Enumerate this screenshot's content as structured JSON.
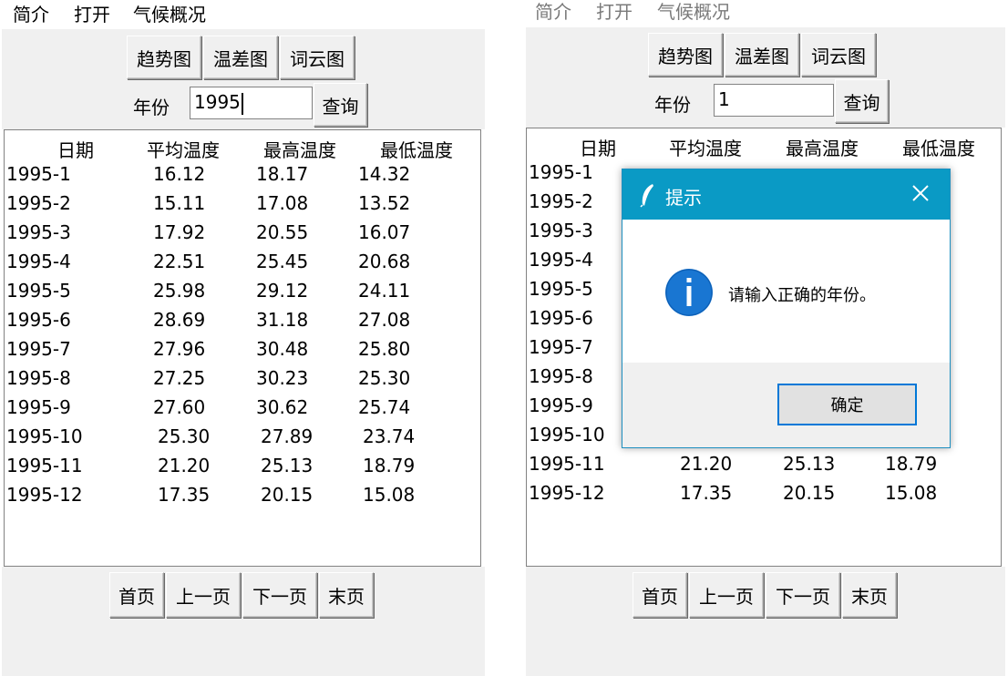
{
  "menu": [
    "简介",
    "打开",
    "气候概况"
  ],
  "chart_buttons": [
    "趋势图",
    "温差图",
    "词云图"
  ],
  "year_label": "年份",
  "query_label": "查询",
  "columns": [
    "日期",
    "平均温度",
    "最高温度",
    "最低温度"
  ],
  "rows": [
    [
      "1995-1",
      "16.12",
      "18.17",
      "14.32"
    ],
    [
      "1995-2",
      "15.11",
      "17.08",
      "13.52"
    ],
    [
      "1995-3",
      "17.92",
      "20.55",
      "16.07"
    ],
    [
      "1995-4",
      "22.51",
      "25.45",
      "20.68"
    ],
    [
      "1995-5",
      "25.98",
      "29.12",
      "24.11"
    ],
    [
      "1995-6",
      "28.69",
      "31.18",
      "27.08"
    ],
    [
      "1995-7",
      "27.96",
      "30.48",
      "25.80"
    ],
    [
      "1995-8",
      "27.25",
      "30.23",
      "25.30"
    ],
    [
      "1995-9",
      "27.60",
      "30.62",
      "25.74"
    ],
    [
      "1995-10",
      "25.30",
      "27.89",
      "23.74"
    ],
    [
      "1995-11",
      "21.20",
      "25.13",
      "18.79"
    ],
    [
      "1995-12",
      "17.35",
      "20.15",
      "15.08"
    ]
  ],
  "pager": [
    "首页",
    "上一页",
    "下一页",
    "末页"
  ],
  "left": {
    "year_value": "1995"
  },
  "right": {
    "year_value": "1",
    "visible_rows": [
      [
        "1995-1",
        "",
        "",
        ""
      ],
      [
        "1995-2",
        "",
        "",
        ""
      ],
      [
        "1995-3",
        "",
        "",
        ""
      ],
      [
        "1995-4",
        "",
        "",
        ""
      ],
      [
        "1995-5",
        "",
        "",
        ""
      ],
      [
        "1995-6",
        "",
        "",
        ""
      ],
      [
        "1995-7",
        "",
        "",
        ""
      ],
      [
        "1995-8",
        "",
        "",
        ""
      ],
      [
        "1995-9",
        "",
        "",
        ""
      ],
      [
        "1995-10",
        "",
        "",
        ""
      ],
      [
        "1995-11",
        "21.20",
        "25.13",
        "18.79"
      ],
      [
        "1995-12",
        "17.35",
        "20.15",
        "15.08"
      ]
    ]
  },
  "dialog": {
    "title": "提示",
    "message": "请输入正确的年份。",
    "ok": "确定",
    "title_icon": "feather-icon",
    "info_icon": "info-icon",
    "accent": "#0a9ac5"
  }
}
